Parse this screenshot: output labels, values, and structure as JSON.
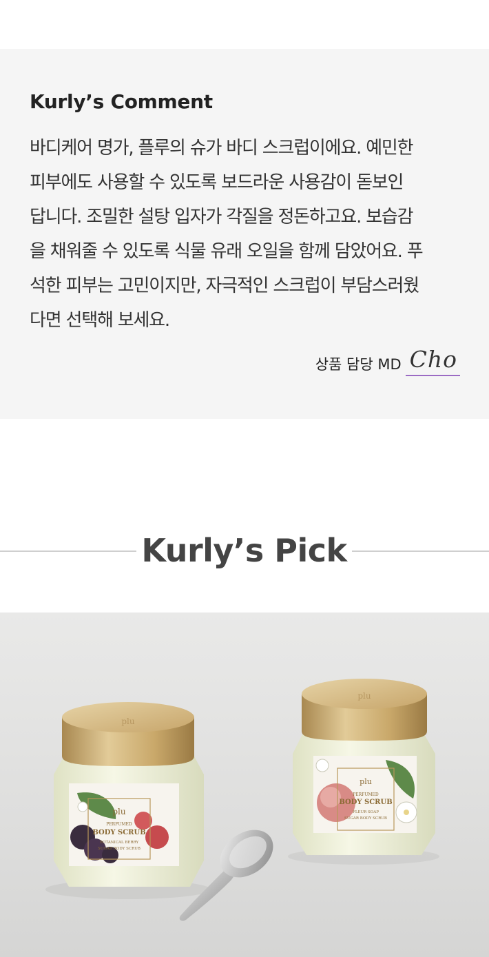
{
  "comment": {
    "title": "Kurly’s Comment",
    "lines": [
      "바디케어 명가, 플루의 슈가 바디 스크럽이에요. 예민한",
      "피부에도 사용할 수 있도록 보드라운 사용감이 돋보인",
      "답니다. 조밀한 설탕 입자가 각질을 정돈하고요. 보습감",
      "을 채워줄 수 있도록 식물 유래 오일을 함께 담았어요. 푸",
      "석한 피부는 고민이지만, 자극적인 스크럽이 부담스러웠",
      "다면 선택해 보세요."
    ],
    "signature_label": "상품 담당 MD",
    "signature_name": "Cho"
  },
  "pick": {
    "title": "Kurly’s Pick"
  },
  "product_photo": {
    "jar_left": {
      "lid_brand": "plu",
      "brand": "plu",
      "line1": "PERFUMED",
      "line2": "BODY SCRUB",
      "line3": "BOTANICAL BERRY",
      "line4": "SUGAR BODY SCRUB"
    },
    "jar_right": {
      "lid_brand": "plu",
      "brand": "plu",
      "line1": "PERFUMED",
      "line2": "BODY SCRUB",
      "line3": "FLEUR SOAP",
      "line4": "SUGAR BODY SCRUB"
    },
    "colors": {
      "lid_gold": "#c9a86a",
      "jar_cream": "#eef0d8",
      "label_gold": "#b8965a"
    }
  }
}
